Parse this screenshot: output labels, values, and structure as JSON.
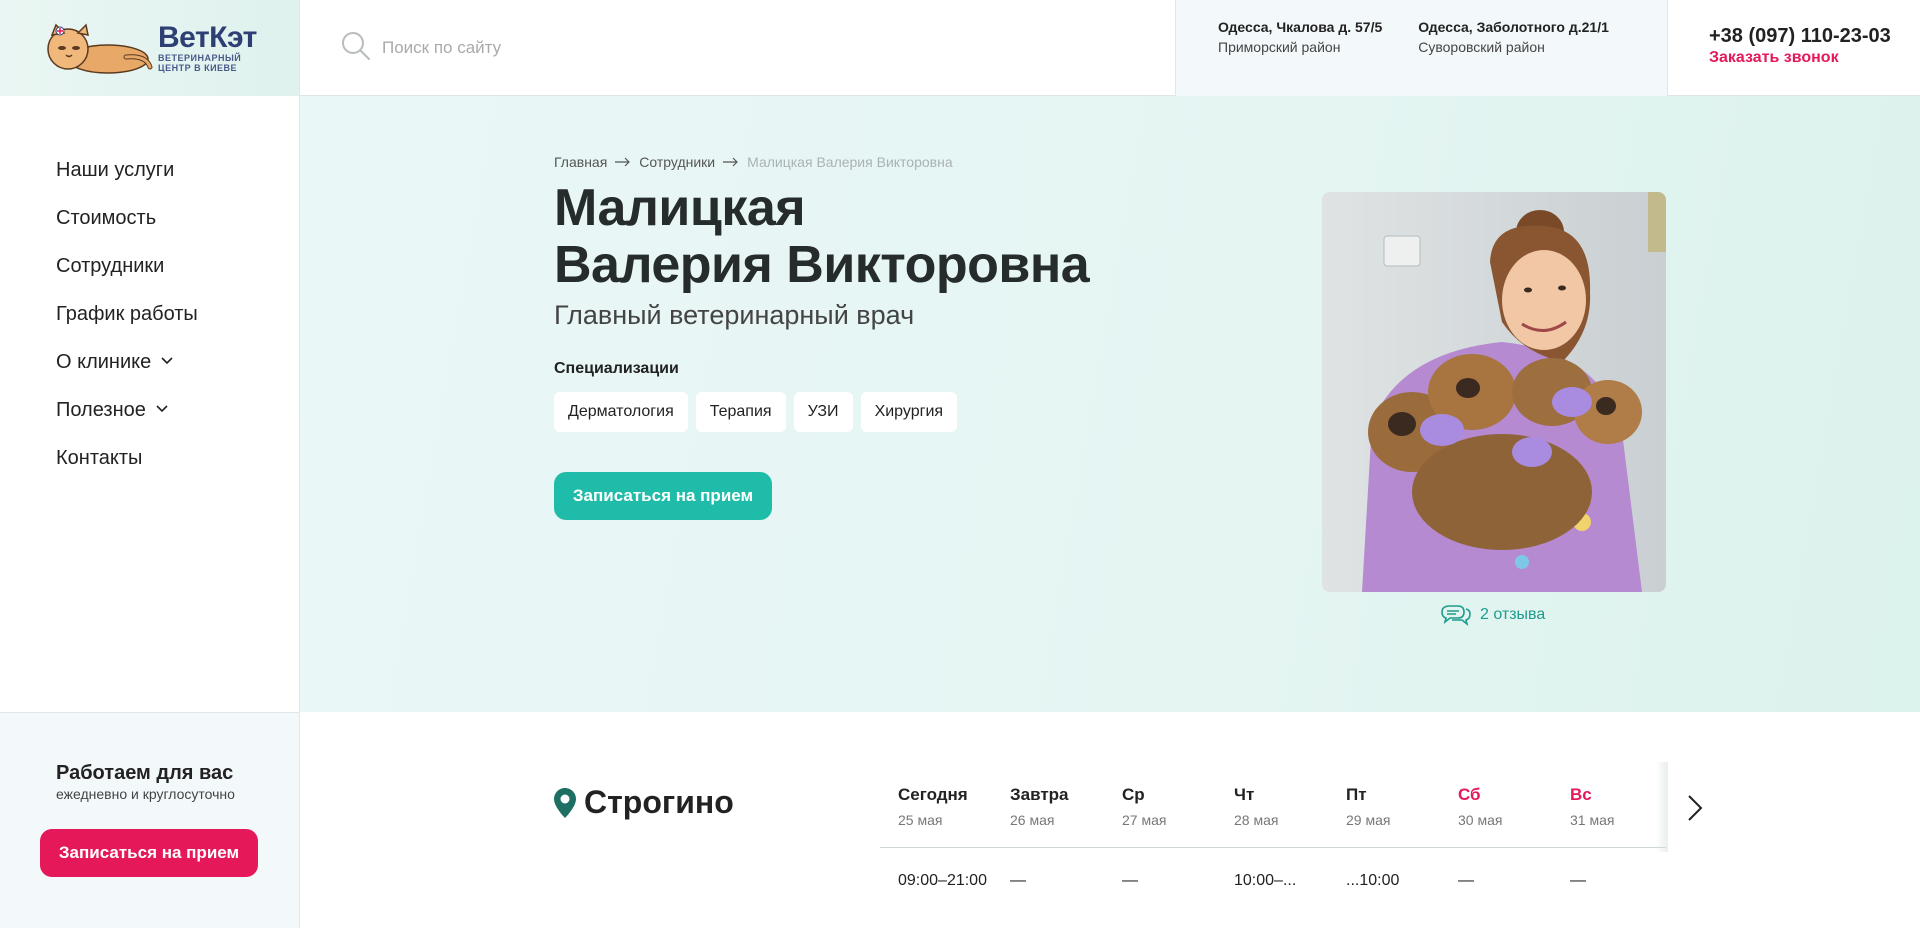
{
  "header": {
    "logo_name": "ВетКэт",
    "logo_sub_1": "ВЕТЕРИНАРНЫЙ",
    "logo_sub_2": "ЦЕНТР В КИЕВЕ",
    "search_placeholder": "Поиск по сайту",
    "addresses": [
      {
        "street": "Одесса, Чкалова д. 57/5",
        "district": "Приморский район"
      },
      {
        "street": "Одесса, Заболотного д.21/1",
        "district": "Суворовский район"
      }
    ],
    "phone": "+38 (097) 110-23-03",
    "callback": "Заказать звонок"
  },
  "sidebar": {
    "items": [
      {
        "label": "Наши услуги"
      },
      {
        "label": "Стоимость"
      },
      {
        "label": "Сотрудники"
      },
      {
        "label": "График работы"
      },
      {
        "label": "О клинике",
        "has_dropdown": true
      },
      {
        "label": "Полезное",
        "has_dropdown": true
      },
      {
        "label": "Контакты"
      }
    ],
    "work_title": "Работаем для вас",
    "work_sub": "ежедневно и круглосуточно",
    "appointment_button": "Записаться на прием"
  },
  "hero": {
    "breadcrumb": [
      "Главная",
      "Сотрудники",
      "Малицкая Валерия Викторовна"
    ],
    "name_line1": "Малицкая",
    "name_line2": "Валерия Викторовна",
    "position": "Главный ветеринарный врач",
    "spec_label": "Специализации",
    "specializations": [
      "Дерматология",
      "Терапия",
      "УЗИ",
      "Хирургия"
    ],
    "appointment_button": "Записаться на прием",
    "reviews": "2 отзыва"
  },
  "schedule": {
    "location": "Строгино",
    "days": [
      {
        "name": "Сегодня",
        "date": "25 мая",
        "time": "09:00–21:00",
        "weekend": false
      },
      {
        "name": "Завтра",
        "date": "26 мая",
        "time": "—",
        "weekend": false
      },
      {
        "name": "Ср",
        "date": "27 мая",
        "time": "—",
        "weekend": false
      },
      {
        "name": "Чт",
        "date": "28 мая",
        "time": "10:00–...",
        "weekend": false
      },
      {
        "name": "Пт",
        "date": "29 мая",
        "time": "...10:00",
        "weekend": false
      },
      {
        "name": "Сб",
        "date": "30 мая",
        "time": "—",
        "weekend": true
      },
      {
        "name": "Вс",
        "date": "31 мая",
        "time": "—",
        "weekend": true
      }
    ]
  },
  "colors": {
    "accent_red": "#e5195a",
    "accent_green": "#1fbda9",
    "brand_blue": "#2d3f73"
  }
}
